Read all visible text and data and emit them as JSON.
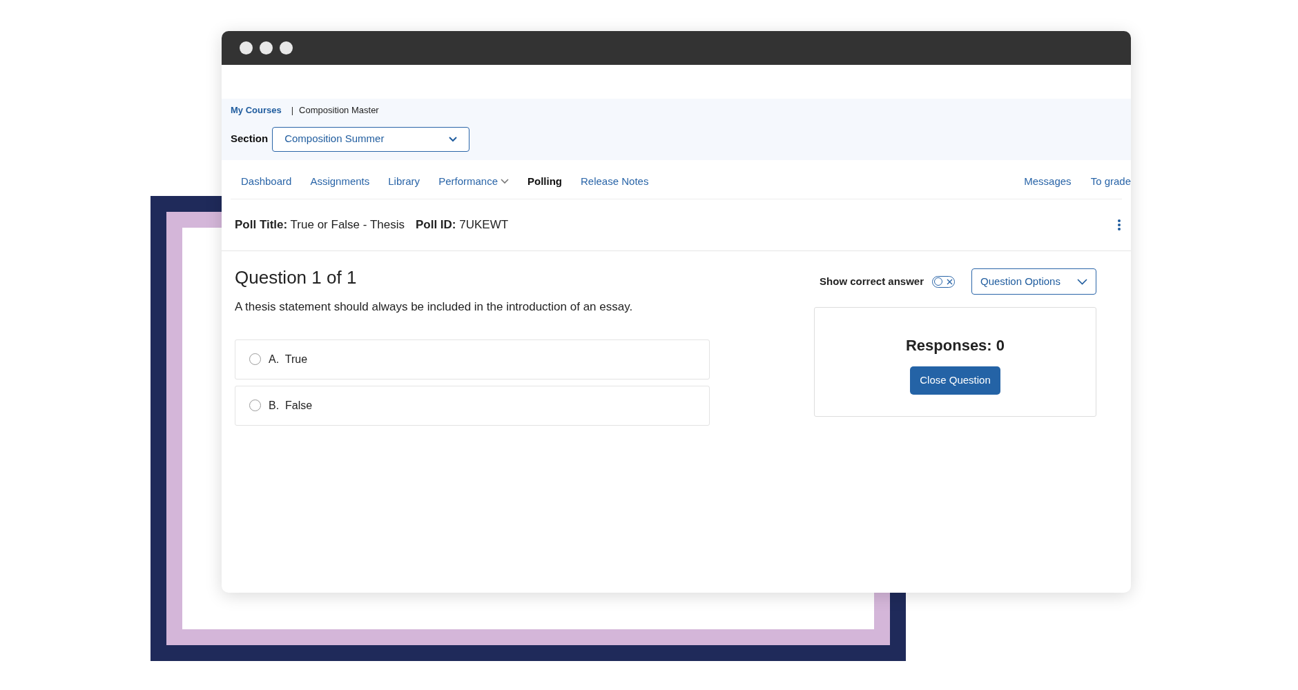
{
  "breadcrumb": {
    "link": "My Courses",
    "separator": "|",
    "current": "Composition Master"
  },
  "section": {
    "label": "Section",
    "value": "Composition Summer"
  },
  "nav": {
    "left": [
      {
        "label": "Dashboard",
        "kind": "link",
        "selected": false
      },
      {
        "label": "Assignments",
        "kind": "link",
        "selected": false
      },
      {
        "label": "Library",
        "kind": "link",
        "selected": false
      },
      {
        "label": "Performance",
        "kind": "dropdown",
        "selected": false
      },
      {
        "label": "Polling",
        "kind": "link",
        "selected": true
      },
      {
        "label": "Release Notes",
        "kind": "link",
        "selected": false
      }
    ],
    "right": [
      {
        "label": "Messages",
        "kind": "link",
        "selected": false
      },
      {
        "label": "To grade",
        "kind": "link",
        "selected": false
      }
    ]
  },
  "poll": {
    "title_label": "Poll Title:",
    "title": "True or False - Thesis",
    "id_label": "Poll ID:",
    "id": "7UKEWT"
  },
  "question": {
    "heading": "Question 1 of 1",
    "statement": "A thesis statement should always be included in the introduction of an essay.",
    "options": [
      {
        "letter": "A.",
        "text": "True",
        "checked": false
      },
      {
        "letter": "B.",
        "text": "False",
        "checked": false
      }
    ]
  },
  "show_correct_answer": {
    "label": "Show correct answer",
    "on": false
  },
  "question_options": "Question Options",
  "responses": {
    "text": "Responses: 0",
    "button": "Close Question"
  }
}
